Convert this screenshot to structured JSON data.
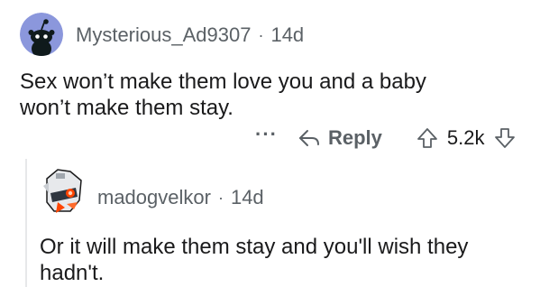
{
  "comments": [
    {
      "author": "Mysterious_Ad9307",
      "separator": "·",
      "age": "14d",
      "avatar_icon": "reddit-snoo-icon",
      "text": "Sex won’t make them love you and a baby won’t make them stay.",
      "actions": {
        "more_label": "···",
        "reply_label": "Reply",
        "score": "5.2k"
      }
    },
    {
      "author": "madogvelkor",
      "separator": "·",
      "age": "14d",
      "avatar_icon": "robot-avatar-icon",
      "text": "Or it will make them stay and you'll wish they hadn't."
    }
  ],
  "colors": {
    "meta_text": "#5b6166",
    "avatar_bg": "#8b97dc",
    "thread_line": "#e7e8ea"
  }
}
